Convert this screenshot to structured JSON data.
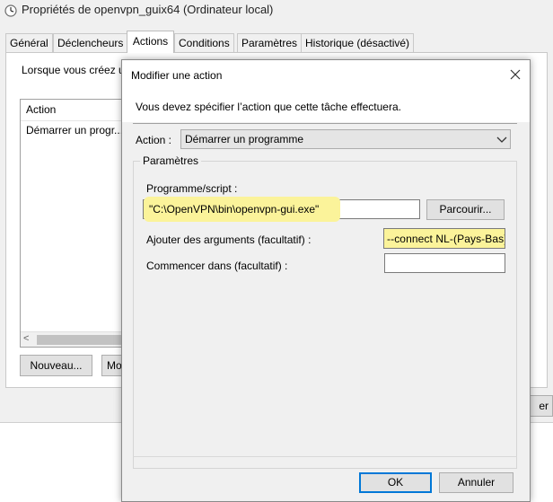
{
  "back_window": {
    "title": "Propriétés de openvpn_guix64 (Ordinateur local)",
    "tabs": [
      {
        "label": "Général",
        "active": false
      },
      {
        "label": "Déclencheurs",
        "active": false
      },
      {
        "label": "Actions",
        "active": true
      },
      {
        "label": "Conditions",
        "active": false
      },
      {
        "label": "Paramètres",
        "active": false
      },
      {
        "label": "Historique (désactivé)",
        "active": false
      }
    ],
    "description_fragment": "Lorsque vous créez u",
    "list": {
      "header": "Action",
      "rows": [
        "Démarrer un progr..."
      ]
    },
    "scroll_left_glyph": "<",
    "new_button": "Nouveau...",
    "modify_button_fragment": "Mo",
    "right_button_fragment": "er"
  },
  "dialog": {
    "title": "Modifier une action",
    "instruction": "Vous devez spécifier l’action que cette tâche effectuera.",
    "action_label": "Action :",
    "action_value": "Démarrer un programme",
    "params_group_label": "Paramètres",
    "program_label": "Programme/script :",
    "program_value": "\"C:\\OpenVPN\\bin\\openvpn-gui.exe\"",
    "browse_button": "Parcourir...",
    "args_label": "Ajouter des arguments (facultatif) :",
    "args_value": "--connect NL-(Pays-Bas)",
    "start_label": "Commencer dans (facultatif) :",
    "start_value": "",
    "ok_button": "OK",
    "cancel_button": "Annuler"
  },
  "colors": {
    "highlight": "#fbf39a",
    "default_button_border": "#0078d7",
    "window_bg": "#f0f0f0"
  },
  "icons": {
    "window_icon": "clock-icon",
    "close": "close-icon",
    "dropdown": "chevron-down-icon"
  }
}
